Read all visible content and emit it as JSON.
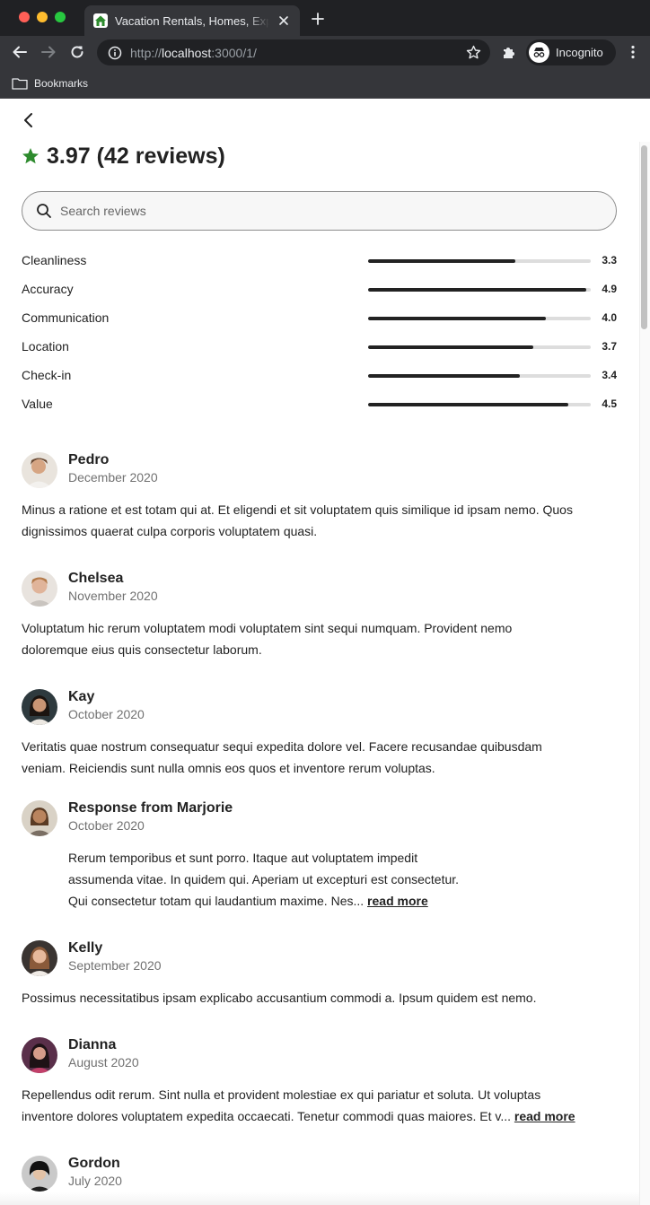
{
  "browser": {
    "tab_title": "Vacation Rentals, Homes, Experiences & Places",
    "url_scheme": "http://",
    "url_host": "localhost",
    "url_path": ":3000/1/",
    "profile_label": "Incognito",
    "bookmarks_label": "Bookmarks"
  },
  "header": {
    "rating": "3.97",
    "review_count": "(42 reviews)",
    "star_color": "#2e8b2e"
  },
  "search": {
    "placeholder": "Search reviews"
  },
  "categories": [
    {
      "label": "Cleanliness",
      "score": "3.3",
      "fraction": 0.66
    },
    {
      "label": "Accuracy",
      "score": "4.9",
      "fraction": 0.98
    },
    {
      "label": "Communication",
      "score": "4.0",
      "fraction": 0.8
    },
    {
      "label": "Location",
      "score": "3.7",
      "fraction": 0.74
    },
    {
      "label": "Check-in",
      "score": "3.4",
      "fraction": 0.68
    },
    {
      "label": "Value",
      "score": "4.5",
      "fraction": 0.9
    }
  ],
  "reviews": [
    {
      "name": "Pedro",
      "date": "December 2020",
      "text1": "Minus a ratione et est totam qui at. Et eligendi et sit voluptatem quis similique id ipsam nemo. Quos",
      "text2": "dignissimos quaerat culpa corporis voluptatem quasi."
    },
    {
      "name": "Chelsea",
      "date": "November 2020",
      "text1": "Voluptatum hic rerum voluptatem modi voluptatem sint sequi numquam. Provident nemo",
      "text2": "doloremque eius quis consectetur laborum."
    },
    {
      "name": "Kay",
      "date": "October 2020",
      "text1": "Veritatis quae nostrum consequatur sequi expedita dolore vel. Facere recusandae quibusdam",
      "text2": "veniam. Reiciendis sunt nulla omnis eos quos et inventore rerum voluptas.",
      "response": {
        "name": "Response from Marjorie",
        "date": "October 2020",
        "text1": "Rerum temporibus et sunt porro. Itaque aut voluptatem impedit",
        "text2": "assumenda vitae. In quidem qui. Aperiam ut excepturi est consectetur.",
        "text3": "Qui consectetur totam qui laudantium maxime. Nes...",
        "read_more": "read more"
      }
    },
    {
      "name": "Kelly",
      "date": "September 2020",
      "text1": "Possimus necessitatibus ipsam explicabo accusantium commodi a. Ipsum quidem est nemo."
    },
    {
      "name": "Dianna",
      "date": "August 2020",
      "text1": "Repellendus odit rerum. Sint nulla et provident molestiae ex qui pariatur et soluta. Ut voluptas",
      "text2": "inventore dolores voluptatem expedita occaecati. Tenetur commodi quas maiores. Et v...",
      "read_more": "read more"
    },
    {
      "name": "Gordon",
      "date": "July 2020"
    }
  ]
}
